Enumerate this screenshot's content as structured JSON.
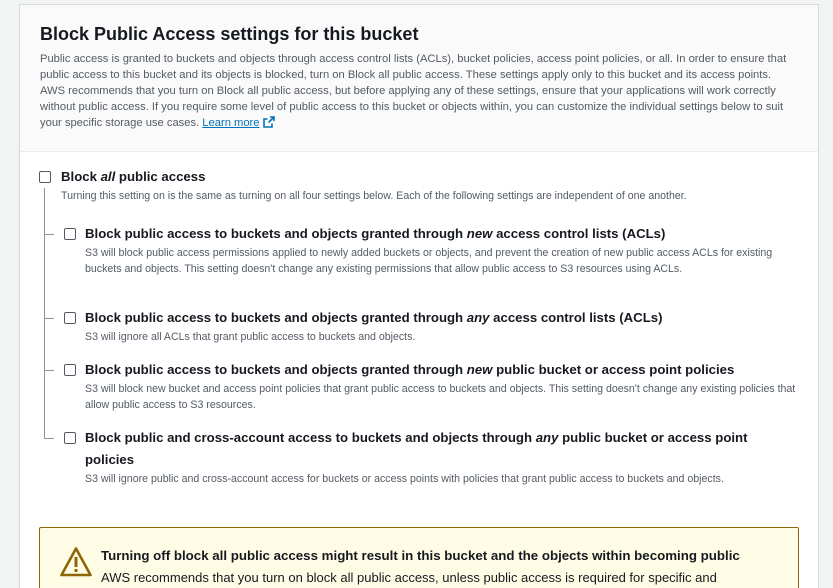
{
  "header": {
    "title": "Block Public Access settings for this bucket",
    "description": "Public access is granted to buckets and objects through access control lists (ACLs), bucket policies, access point policies, or all. In order to ensure that public access to this bucket and its objects is blocked, turn on Block all public access. These settings apply only to this bucket and its access points. AWS recommends that you turn on Block all public access, but before applying any of these settings, ensure that your applications will work correctly without public access. If you require some level of public access to this bucket or objects within, you can customize the individual settings below to suit your specific storage use cases.",
    "learn_more": "Learn more",
    "learn_more_icon": "external-link-icon"
  },
  "block_all": {
    "label_before": "Block ",
    "label_em": "all",
    "label_after": " public access",
    "checked": false,
    "description": "Turning this setting on is the same as turning on all four settings below. Each of the following settings are independent of one another."
  },
  "settings": [
    {
      "label_before": "Block public access to buckets and objects granted through ",
      "label_em": "new",
      "label_after": " access control lists (ACLs)",
      "checked": false,
      "description": "S3 will block public access permissions applied to newly added buckets or objects, and prevent the creation of new public access ACLs for existing buckets and objects. This setting doesn't change any existing permissions that allow public access to S3 resources using ACLs."
    },
    {
      "label_before": "Block public access to buckets and objects granted through ",
      "label_em": "any",
      "label_after": " access control lists (ACLs)",
      "checked": false,
      "description": "S3 will ignore all ACLs that grant public access to buckets and objects."
    },
    {
      "label_before": "Block public access to buckets and objects granted through ",
      "label_em": "new",
      "label_after": " public bucket or access point policies",
      "checked": false,
      "description": "S3 will block new bucket and access point policies that grant public access to buckets and objects. This setting doesn't change any existing policies that allow public access to S3 resources."
    },
    {
      "label_before": "Block public and cross-account access to buckets and objects through ",
      "label_em": "any",
      "label_after": " public bucket or access point",
      "label_line2": "policies",
      "checked": false,
      "description": "S3 will ignore public and cross-account access for buckets or access points with policies that grant public access to buckets and objects."
    }
  ],
  "warning": {
    "icon": "warning-icon",
    "title": "Turning off block all public access might result in this bucket and the objects within becoming public",
    "text": "AWS recommends that you turn on block all public access, unless public access is required for specific and",
    "color": "#8d6605"
  }
}
